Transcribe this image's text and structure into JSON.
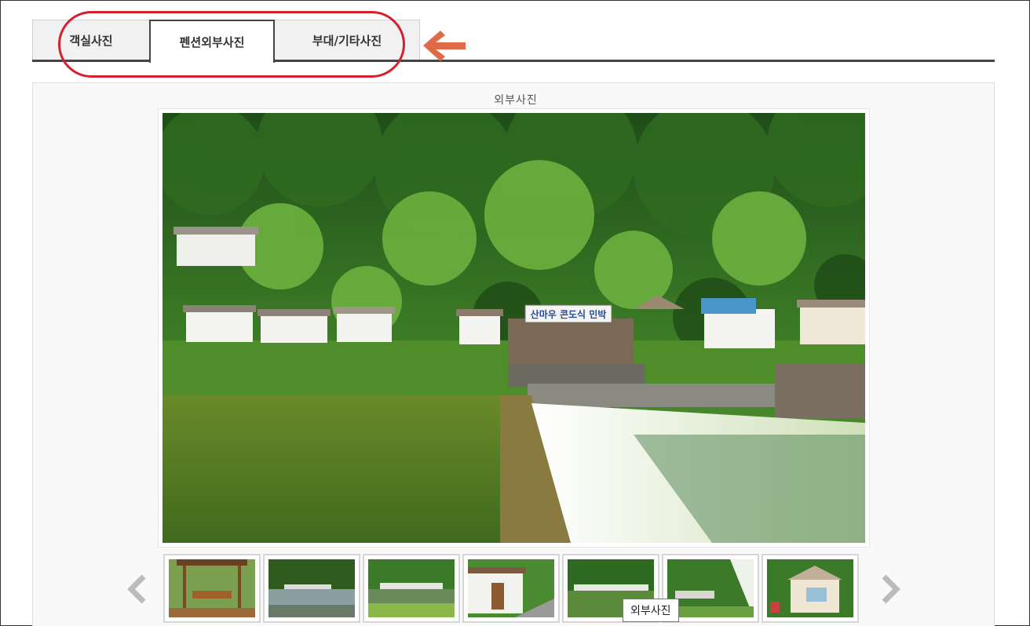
{
  "tabs": [
    {
      "label": "객실사진",
      "active": false
    },
    {
      "label": "펜션외부사진",
      "active": true
    },
    {
      "label": "부대/기타사진",
      "active": false
    }
  ],
  "gallery": {
    "caption": "외부사진",
    "main_photo_sign": "산마우 콘도식 민박",
    "thumbnail_count": 7,
    "tooltip": "외부사진"
  },
  "colors": {
    "highlight_oval": "#d4212f",
    "arrow": "#e06a45",
    "tab_border_active": "#444444"
  },
  "icons": {
    "prev": "chevron-left-icon",
    "next": "chevron-right-icon",
    "annotation": "arrow-left-icon"
  }
}
